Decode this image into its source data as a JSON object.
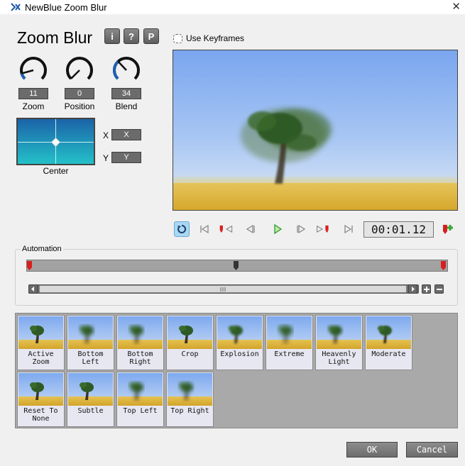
{
  "window": {
    "title": "NewBlue Zoom Blur",
    "close_glyph": "✕"
  },
  "heading": "Zoom Blur",
  "header_buttons": [
    {
      "label": "i",
      "name": "info"
    },
    {
      "label": "?",
      "name": "help"
    },
    {
      "label": "P",
      "name": "presets"
    }
  ],
  "keyframes_label": "Use Keyframes",
  "knobs": [
    {
      "label": "Zoom",
      "value": "11",
      "level": 0.11
    },
    {
      "label": "Position",
      "value": "0",
      "level": 0.0
    },
    {
      "label": "Blend",
      "value": "34",
      "level": 0.34
    }
  ],
  "center": {
    "label": "Center",
    "x_label": "X",
    "x_value": "X",
    "y_label": "Y",
    "y_value": "Y"
  },
  "timecode": "00:01.12",
  "automation_label": "Automation",
  "presets": [
    {
      "label": "Active Zoom"
    },
    {
      "label": "Bottom Left"
    },
    {
      "label": "Bottom Right"
    },
    {
      "label": "Crop"
    },
    {
      "label": "Explosion"
    },
    {
      "label": "Extreme"
    },
    {
      "label": "Heavenly Light"
    },
    {
      "label": "Moderate"
    },
    {
      "label": "Reset To None"
    },
    {
      "label": "Subtle"
    },
    {
      "label": "Top Left"
    },
    {
      "label": "Top Right"
    }
  ],
  "buttons": {
    "ok": "OK",
    "cancel": "Cancel"
  },
  "colors": {
    "accent": "#1e5fb4",
    "marker": "#d81e1e",
    "add": "#2fa82f"
  }
}
